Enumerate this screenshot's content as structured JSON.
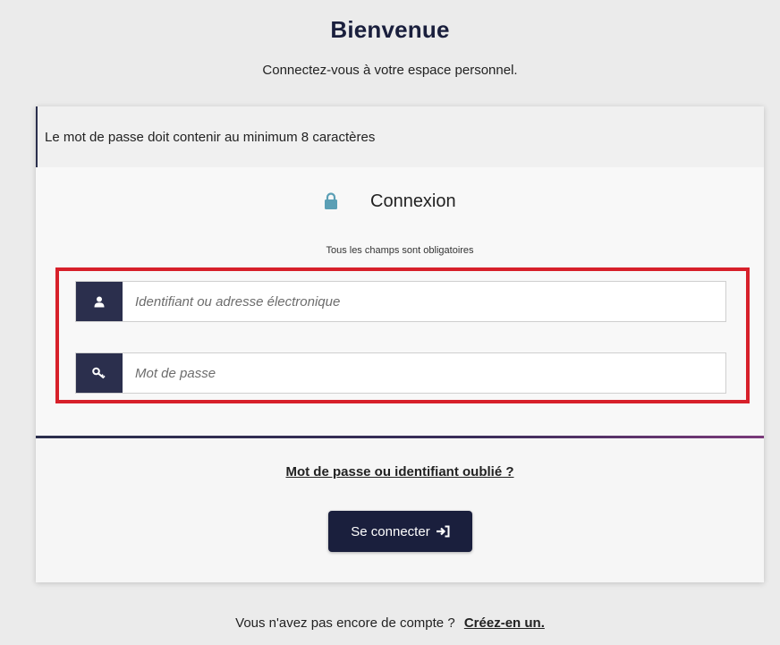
{
  "header": {
    "title": "Bienvenue",
    "subtitle": "Connectez-vous à votre espace personnel."
  },
  "notice": {
    "text": "Le mot de passe doit contenir au minimum 8 caractères"
  },
  "login_form": {
    "heading": "Connexion",
    "heading_icon": "lock-icon",
    "required_note": "Tous les champs sont obligatoires",
    "username": {
      "icon": "user-icon",
      "placeholder": "Identifiant ou adresse électronique",
      "value": ""
    },
    "password": {
      "icon": "key-icon",
      "placeholder": "Mot de passe",
      "value": ""
    },
    "forgot_link": "Mot de passe ou identifiant oublié ?",
    "submit_label": "Se connecter",
    "submit_icon": "sign-in-icon"
  },
  "footer": {
    "prompt": "Vous n'avez pas encore de compte ?",
    "signup_link": "Créez-en un."
  },
  "colors": {
    "primary": "#1a1f3d",
    "icon_bg": "#2b2f4d",
    "highlight": "#d7202a",
    "lock": "#5b9fb5",
    "background": "#ebebeb"
  }
}
